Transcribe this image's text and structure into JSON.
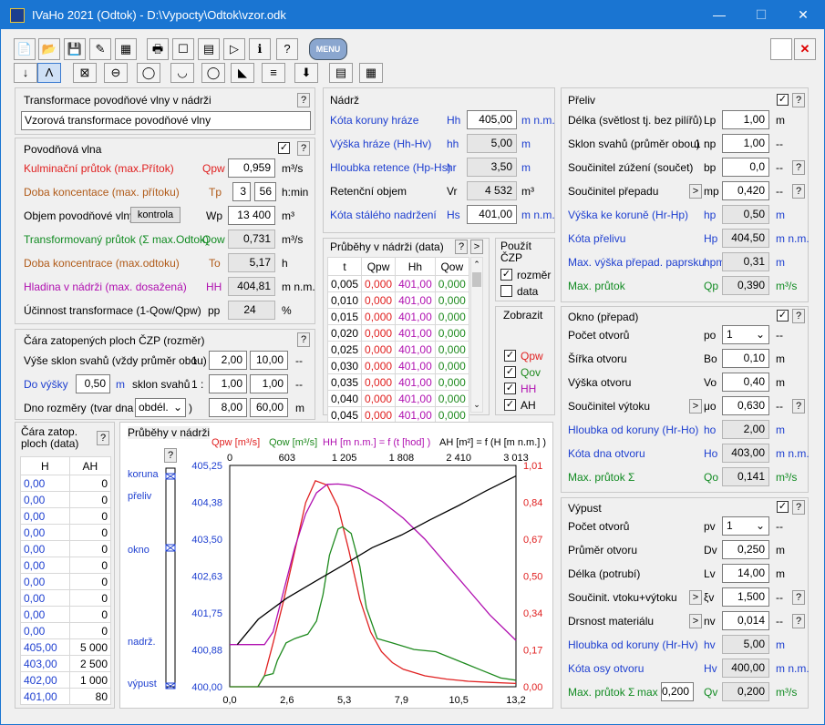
{
  "title": "IVaHo 2021 (Odtok) - D:\\Vypocty\\Odtok\\vzor.odk",
  "window_buttons": [
    "—",
    "☐",
    "✕"
  ],
  "transform": {
    "header": "Transformace povodňové vlny v nádrži",
    "name": "Vzorová transformace povodňové vlny"
  },
  "flood": {
    "header": "Povodňová vlna",
    "kulminacni": {
      "label": "Kulminační průtok (max.Přítok)",
      "sym": "Qpw",
      "val": "0,959",
      "unit": "m³/s"
    },
    "doba": {
      "label": "Doba koncentace (max. přítoku)",
      "sym": "Tp",
      "h": "3",
      "m": "56",
      "unit": "h:min"
    },
    "objem": {
      "label": "Objem povodňové vlny",
      "btn": "kontrola",
      "sym": "Wp",
      "val": "13 400",
      "unit": "m³"
    },
    "transf": {
      "label": "Transformovaný průtok (Σ max.Odtok)",
      "sym": "Qow",
      "val": "0,731",
      "unit": "m³/s"
    },
    "doba2": {
      "label": "Doba koncentrace (max.odtoku)",
      "sym": "To",
      "val": "5,17",
      "unit": "h"
    },
    "hladina": {
      "label": "Hladina v nádrži (max. dosažená)",
      "sym": "HH",
      "val": "404,81",
      "unit": "m n.m."
    },
    "ucinnost": {
      "label": "Účinnost transformace (1-Qow/Qpw)",
      "sym": "pp",
      "val": "24",
      "unit": "%"
    }
  },
  "cara": {
    "header": "Čára zatopených ploch ČZP (rozměr)",
    "row1": {
      "label": "Výše sklon svahů (vždy průměr obou)",
      "pre": "1 :",
      "a": "2,00",
      "b": "10,00",
      "unit": "--"
    },
    "row2": {
      "label": "Do výšky",
      "val": "0,50",
      "u": "m",
      "label2": "sklon svahů",
      "pre": "1 :",
      "a": "1,00",
      "b": "1,00",
      "unit": "--"
    },
    "row3": {
      "label": "Dno rozměry",
      "sub": "(tvar dna",
      "sel": "obdél.",
      "a": "8,00",
      "b": "60,00",
      "unit": "m"
    }
  },
  "nadrz": {
    "header": "Nádrž",
    "rows": [
      {
        "label": "Kóta koruny hráze",
        "sym": "Hh",
        "val": "405,00",
        "unit": "m n.m."
      },
      {
        "label": "Výška hráze (Hh-Hv)",
        "sym": "hh",
        "val": "5,00",
        "unit": "m"
      },
      {
        "label": "Hloubka retence (Hp-Hs)",
        "sym": "hr",
        "val": "3,50",
        "unit": "m"
      },
      {
        "label": "Retenční objem",
        "sym": "Vr",
        "val": "4 532",
        "unit": "m³"
      },
      {
        "label": "Kóta stálého nadržení",
        "sym": "Hs",
        "val": "401,00",
        "unit": "m n.m."
      }
    ]
  },
  "pruby": {
    "header": "Průběhy v nádrži (data)",
    "cols": [
      "t",
      "Qpw",
      "Hh",
      "Qow"
    ],
    "rows": [
      [
        "0,005",
        "0,000",
        "401,00",
        "0,000"
      ],
      [
        "0,010",
        "0,000",
        "401,00",
        "0,000"
      ],
      [
        "0,015",
        "0,000",
        "401,00",
        "0,000"
      ],
      [
        "0,020",
        "0,000",
        "401,00",
        "0,000"
      ],
      [
        "0,025",
        "0,000",
        "401,00",
        "0,000"
      ],
      [
        "0,030",
        "0,000",
        "401,00",
        "0,000"
      ],
      [
        "0,035",
        "0,000",
        "401,00",
        "0,000"
      ],
      [
        "0,040",
        "0,000",
        "401,00",
        "0,000"
      ],
      [
        "0,045",
        "0,000",
        "401,00",
        "0,000"
      ]
    ]
  },
  "pouzit": {
    "header": "Použít ČZP",
    "items": [
      "rozměr",
      "data"
    ]
  },
  "zobrazit": {
    "header": "Zobrazit",
    "items": [
      "Qpw",
      "Qov",
      "HH",
      "AH"
    ]
  },
  "preliv": {
    "header": "Přeliv",
    "rows": [
      {
        "label": "Délka (světlost tj. bez pilířů)",
        "sym": "Lp",
        "val": "1,00",
        "unit": "m"
      },
      {
        "label": "Sklon svahů (průměr obou)",
        "pre": "1 :",
        "sym": "np",
        "val": "1,00",
        "unit": "--"
      },
      {
        "label": "Součinitel zúžení (součet)",
        "sym": "bp",
        "val": "0,0",
        "unit": "--"
      },
      {
        "label": "Součinitel přepadu",
        "sym": "mp",
        "val": "0,420",
        "unit": "--"
      },
      {
        "label": "Výška ke koruně (Hr-Hp)",
        "sym": "hp",
        "val": "0,50",
        "unit": "m"
      },
      {
        "label": "Kóta přelivu",
        "sym": "Hp",
        "val": "404,50",
        "unit": "m n.m."
      },
      {
        "label": "Max. výška přepad. paprsku",
        "sym": "hpm",
        "val": "0,31",
        "unit": "m"
      },
      {
        "label": "Max. průtok",
        "sym": "Qp",
        "val": "0,390",
        "unit": "m³/s"
      }
    ]
  },
  "okno": {
    "header": "Okno (přepad)",
    "rows": [
      {
        "label": "Počet otvorů",
        "sym": "po",
        "val": "1",
        "unit": "--"
      },
      {
        "label": "Šířka otvoru",
        "sym": "Bo",
        "val": "0,10",
        "unit": "m"
      },
      {
        "label": "Výška otvoru",
        "sym": "Vo",
        "val": "0,40",
        "unit": "m"
      },
      {
        "label": "Součinitel výtoku",
        "sym": "μo",
        "val": "0,630",
        "unit": "--"
      },
      {
        "label": "Hloubka od koruny (Hr-Ho)",
        "sym": "ho",
        "val": "2,00",
        "unit": "m"
      },
      {
        "label": "Kóta dna otvoru",
        "sym": "Ho",
        "val": "403,00",
        "unit": "m n.m."
      },
      {
        "label": "Max. průtok Σ",
        "sym": "Qo",
        "val": "0,141",
        "unit": "m³/s"
      }
    ]
  },
  "vypust": {
    "header": "Výpust",
    "rows": [
      {
        "label": "Počet otvorů",
        "sym": "pv",
        "val": "1",
        "unit": "--"
      },
      {
        "label": "Průměr otvoru",
        "sym": "Dv",
        "val": "0,250",
        "unit": "m"
      },
      {
        "label": "Délka (potrubí)",
        "sym": "Lv",
        "val": "14,00",
        "unit": "m"
      },
      {
        "label": "Součinit. vtoku+výtoku",
        "sym": "ξv",
        "val": "1,500",
        "unit": "--"
      },
      {
        "label": "Drsnost materiálu",
        "sym": "nv",
        "val": "0,014",
        "unit": "--"
      },
      {
        "label": "Hloubka od koruny (Hr-Hv)",
        "sym": "hv",
        "val": "5,00",
        "unit": "m"
      },
      {
        "label": "Kóta osy otvoru",
        "sym": "Hv",
        "val": "400,00",
        "unit": "m n.m."
      },
      {
        "label": "Max. průtok Σ",
        "pre": "max",
        "pre_val": "0,200",
        "sym": "Qv",
        "val": "0,200",
        "unit": "m³/s"
      }
    ]
  },
  "cz_data": {
    "header": "Čára zatop. ploch (data)",
    "cols": [
      "H",
      "AH"
    ],
    "rows": [
      [
        "0,00",
        "0"
      ],
      [
        "0,00",
        "0"
      ],
      [
        "0,00",
        "0"
      ],
      [
        "0,00",
        "0"
      ],
      [
        "0,00",
        "0"
      ],
      [
        "0,00",
        "0"
      ],
      [
        "0,00",
        "0"
      ],
      [
        "0,00",
        "0"
      ],
      [
        "0,00",
        "0"
      ],
      [
        "0,00",
        "0"
      ],
      [
        "405,00",
        "5 000"
      ],
      [
        "403,00",
        "2 500"
      ],
      [
        "402,00",
        "1 000"
      ],
      [
        "401,00",
        "80"
      ]
    ]
  },
  "graph": {
    "header": "Průběhy v nádrži",
    "levels": [
      "koruna",
      "přeliv",
      "okno",
      "nadrž.",
      "výpust"
    ]
  },
  "chart_data": {
    "type": "line",
    "legend": [
      {
        "text": "Qpw [m³/s]",
        "color": "#e02020"
      },
      {
        "text": "Qow [m³/s]",
        "color": "#1e8a1e"
      },
      {
        "text": "HH [m n.m.] = f (t [hod] )",
        "color": "#b010b0"
      },
      {
        "text": "AH [m²] = f (H [m n.m.] )",
        "color": "#000000"
      }
    ],
    "xlabels": [
      "0,0",
      "2,6",
      "5,3",
      "7,9",
      "10,5",
      "13,2"
    ],
    "xlim": [
      0,
      13.2
    ],
    "ylabels_left": [
      "405,25",
      "404,38",
      "403,50",
      "402,63",
      "401,75",
      "400,88",
      "400,00"
    ],
    "ylim_left": [
      400,
      405.25
    ],
    "ylabels_right": [
      "1,01",
      "0,84",
      "0,67",
      "0,50",
      "0,34",
      "0,17",
      "0,00"
    ],
    "ylim_right": [
      0,
      1.01
    ],
    "toplabels": [
      "0",
      "603",
      "1 205",
      "1 808",
      "2 410",
      "3 013"
    ],
    "toplim": [
      0,
      3013
    ],
    "series": [
      {
        "name": "Qpw",
        "color": "#e02020",
        "axis": "right",
        "x": [
          0,
          1.3,
          1.6,
          2.0,
          2.5,
          3.0,
          3.5,
          3.95,
          4.5,
          5.0,
          5.5,
          6.0,
          6.5,
          7.0,
          7.5,
          8,
          9,
          10,
          11,
          12,
          13.2
        ],
        "y": [
          0,
          0,
          0.05,
          0.2,
          0.4,
          0.62,
          0.84,
          0.94,
          0.92,
          0.82,
          0.62,
          0.4,
          0.25,
          0.16,
          0.11,
          0.08,
          0.05,
          0.035,
          0.025,
          0.02,
          0.015
        ]
      },
      {
        "name": "Qow",
        "color": "#1e8a1e",
        "axis": "right",
        "x": [
          0,
          1.3,
          1.6,
          2.0,
          2.2,
          2.6,
          3.0,
          3.6,
          4.0,
          4.3,
          4.6,
          5.0,
          5.2,
          5.6,
          6.0,
          6.3,
          6.8,
          7.5,
          8.5,
          9.5,
          10.5,
          11.5,
          12.5,
          13.2
        ],
        "y": [
          0,
          0,
          0.05,
          0.06,
          0.12,
          0.2,
          0.22,
          0.24,
          0.3,
          0.42,
          0.6,
          0.72,
          0.73,
          0.7,
          0.55,
          0.36,
          0.22,
          0.2,
          0.17,
          0.16,
          0.12,
          0.08,
          0.04,
          0.03
        ]
      },
      {
        "name": "HH",
        "color": "#b010b0",
        "axis": "left",
        "x": [
          0,
          1.6,
          2.0,
          2.5,
          3.0,
          3.5,
          4.0,
          4.5,
          5.0,
          5.5,
          6.0,
          7.0,
          8.0,
          9.0,
          10.0,
          11.0,
          12.0,
          13.2
        ],
        "y": [
          401.0,
          401.0,
          401.3,
          402.3,
          403.3,
          404.1,
          404.6,
          404.8,
          404.81,
          404.78,
          404.7,
          404.4,
          404.0,
          403.5,
          402.9,
          402.3,
          401.7,
          401.1
        ]
      },
      {
        "name": "AH",
        "color": "#000000",
        "axis": "top",
        "x": [
          80,
          300,
          600,
          900,
          1205,
          1500,
          1808,
          2100,
          2410,
          2700,
          3013
        ],
        "y": [
          401.0,
          401.6,
          402.1,
          402.5,
          402.9,
          403.3,
          403.6,
          403.95,
          404.3,
          404.65,
          405.0
        ]
      }
    ]
  },
  "toolbar1": [
    "📄",
    "📂",
    "💾",
    "✎",
    "▦",
    "🖶",
    "☐",
    "▤",
    "▷",
    "ℹ",
    "?",
    "MENU"
  ],
  "toolbar2": [
    "↓",
    "Ʌ",
    "⊠",
    "⊖",
    "◯",
    "◡",
    "◯",
    "◣",
    "≡",
    "⬇",
    "▤",
    "▦"
  ]
}
